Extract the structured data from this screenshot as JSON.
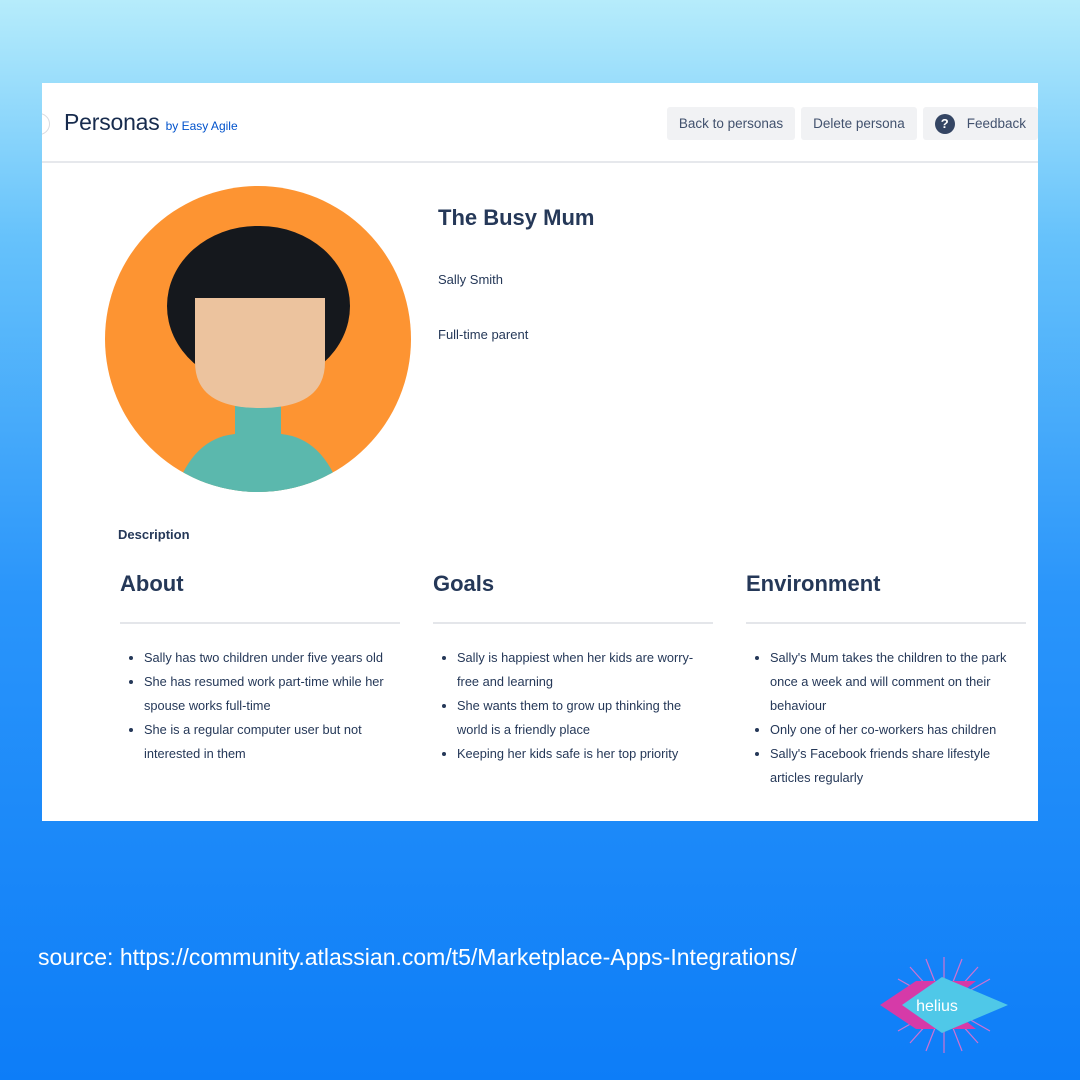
{
  "app": {
    "title": "Personas",
    "subtitle": "by Easy Agile"
  },
  "toolbar": {
    "back_label": "Back to personas",
    "delete_label": "Delete persona",
    "feedback_label": "Feedback",
    "feedback_icon_glyph": "?"
  },
  "persona": {
    "name": "The Busy Mum",
    "person": "Sally Smith",
    "role": "Full-time parent",
    "avatar_colors": {
      "background": "#fd9432",
      "hair": "#15181d",
      "skin": "#ecc39e",
      "top": "#5bb8ad"
    }
  },
  "description": {
    "label": "Description",
    "columns": [
      {
        "heading": "About",
        "items": [
          "Sally has two children under five years old",
          "She has resumed work part-time while her spouse works full-time",
          "She is a regular computer user but not interested in them"
        ]
      },
      {
        "heading": "Goals",
        "items": [
          "Sally is happiest when her kids are worry-free and learning",
          "She wants them to grow up thinking the world is a friendly place",
          "Keeping her kids safe is her top priority"
        ]
      },
      {
        "heading": "Environment",
        "items": [
          "Sally's Mum takes the children to the park once a week and will comment on their behaviour",
          "Only one of her co-workers has children",
          "Sally's Facebook friends share lifestyle articles regularly"
        ]
      }
    ]
  },
  "caption": {
    "source": "source: https://community.atlassian.com/t5/Marketplace-Apps-Integrations/"
  },
  "logo": {
    "text": "helius",
    "colors": {
      "diamond": "#4fc8e8",
      "accent": "#d63aa8",
      "rays": "#ff6fc8"
    }
  }
}
